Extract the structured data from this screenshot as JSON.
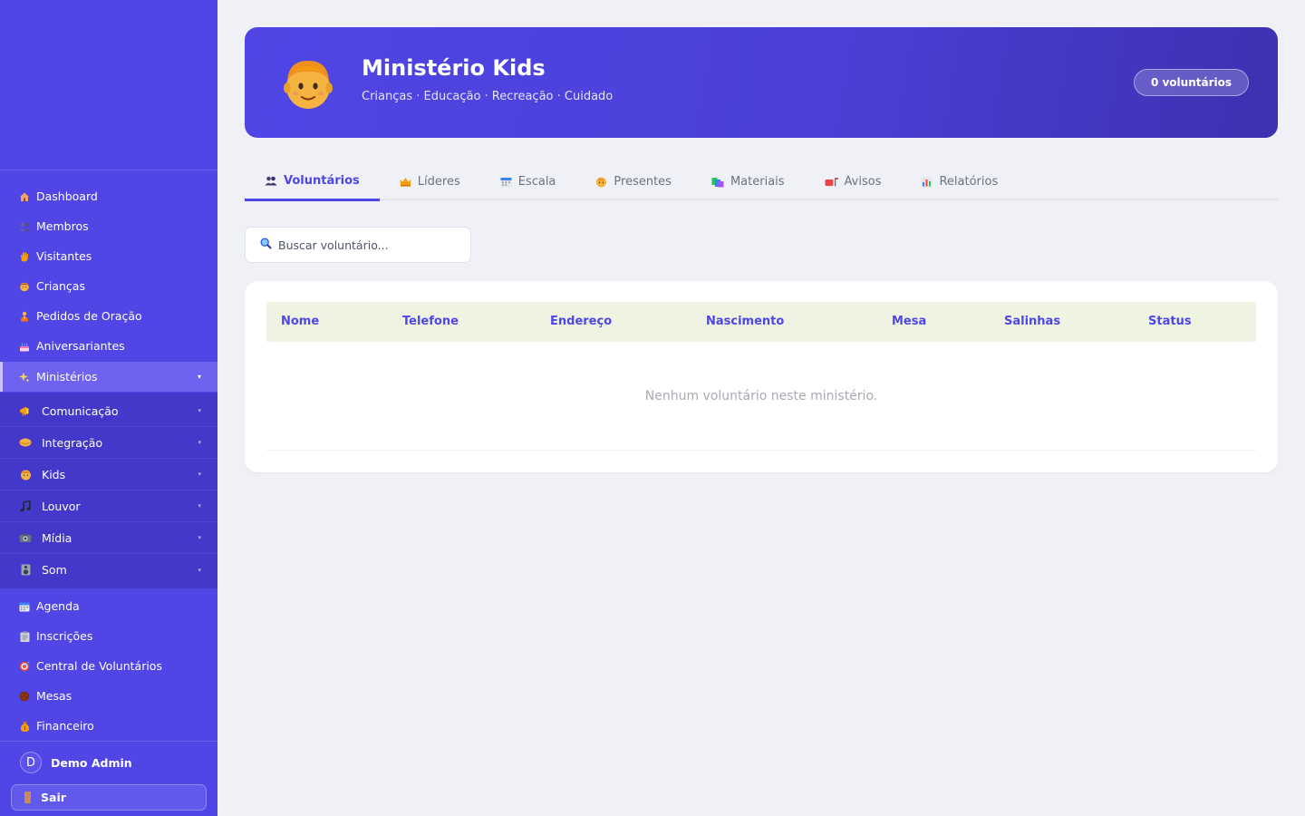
{
  "sidebar": {
    "items_top": [
      {
        "label": "Dashboard",
        "icon": "house-icon"
      },
      {
        "label": "Membros",
        "icon": "people-icon"
      },
      {
        "label": "Visitantes",
        "icon": "hand-wave-icon"
      },
      {
        "label": "Crianças",
        "icon": "child-icon"
      },
      {
        "label": "Pedidos de Oração",
        "icon": "praying-icon"
      },
      {
        "label": "Aniversariantes",
        "icon": "birthday-cake-icon"
      }
    ],
    "active_item": {
      "label": "Ministérios",
      "icon": "sparkles-icon"
    },
    "submenu": [
      {
        "label": "Comunicação",
        "icon": "megaphone-icon"
      },
      {
        "label": "Integração",
        "icon": "handshake-icon"
      },
      {
        "label": "Kids",
        "icon": "child-face-icon"
      },
      {
        "label": "Louvor",
        "icon": "music-note-icon"
      },
      {
        "label": "Mídia",
        "icon": "camera-icon"
      },
      {
        "label": "Som",
        "icon": "speaker-icon"
      }
    ],
    "items_bottom": [
      {
        "label": "Agenda",
        "icon": "calendar-icon"
      },
      {
        "label": "Inscrições",
        "icon": "clipboard-icon"
      },
      {
        "label": "Central de Voluntários",
        "icon": "target-icon"
      },
      {
        "label": "Mesas",
        "icon": "table-icon"
      },
      {
        "label": "Financeiro",
        "icon": "money-bag-icon"
      }
    ],
    "user": {
      "initial": "D",
      "name": "Demo Admin"
    },
    "logout_label": "Sair"
  },
  "hero": {
    "title": "Ministério Kids",
    "subtitle": "Crianças · Educação · Recreação · Cuidado",
    "badge": "0 voluntários",
    "icon": "child-face-icon"
  },
  "tabs": [
    {
      "label": "Voluntários",
      "icon": "people-icon",
      "active": true
    },
    {
      "label": "Líderes",
      "icon": "crown-icon"
    },
    {
      "label": "Escala",
      "icon": "calendar-icon"
    },
    {
      "label": "Presentes",
      "icon": "child-face-icon"
    },
    {
      "label": "Materiais",
      "icon": "books-icon"
    },
    {
      "label": "Avisos",
      "icon": "mailbox-icon"
    },
    {
      "label": "Relatórios",
      "icon": "bar-chart-icon"
    }
  ],
  "search": {
    "placeholder": "Buscar voluntário..."
  },
  "table": {
    "columns": [
      "Nome",
      "Telefone",
      "Endereço",
      "Nascimento",
      "Mesa",
      "Salinhas",
      "Status"
    ],
    "empty_message": "Nenhum voluntário neste ministério."
  },
  "colors": {
    "primary": "#4f46e5",
    "submenu_bg": "#4338ca",
    "active_bg": "#6d63f0",
    "page_bg": "#f0f1f6",
    "table_header_bg": "#eef3e2"
  }
}
